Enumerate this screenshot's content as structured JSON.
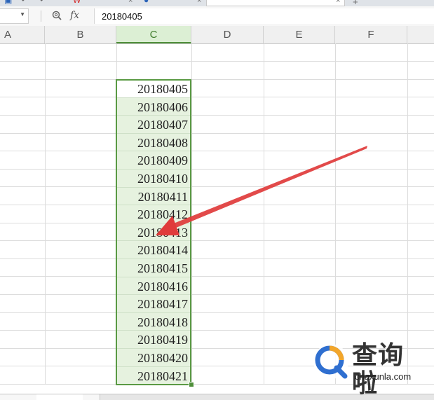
{
  "formula_bar": {
    "cell_value": "20180405",
    "fx_label": "fx"
  },
  "columns": [
    "A",
    "B",
    "C",
    "D",
    "E",
    "F"
  ],
  "selected_column": "C",
  "column_c_values": [
    "20180405",
    "20180406",
    "20180407",
    "20180408",
    "20180409",
    "20180410",
    "20180411",
    "20180412",
    "20180413",
    "20180414",
    "20180415",
    "20180416",
    "20180417",
    "20180418",
    "20180419",
    "20180420",
    "20180421"
  ],
  "watermark": {
    "chinese_text": "查询啦",
    "domain_text": "chaxunla.com"
  },
  "colors": {
    "selection_green": "#5a9a44",
    "selected_fill": "#e6f2df",
    "annotation_arrow": "#e03b3b"
  },
  "icons": {
    "zoom": "magnifier-icon",
    "function": "fx-icon"
  }
}
